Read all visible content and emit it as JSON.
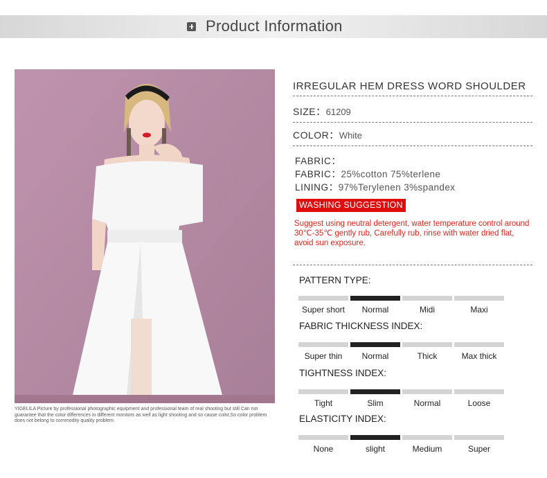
{
  "header": {
    "title": "Product Information",
    "icon": "plus-square-icon"
  },
  "photo": {
    "alt": "model wearing white off-shoulder irregular hem dress"
  },
  "caption": "YIGELILA Picture by professional photographic equipment and professional team of real shooting but still Can not guarantee that the color differences in different monitors as well as light shooting and so cause color,So color problem does not belong to commodity quality problem.",
  "product": {
    "title": "IRREGULAR HEM DRESS WORD SHOULDER",
    "size_label": "SIZE：",
    "size_value": "61209",
    "color_label": "COLOR：",
    "color_value": "White",
    "fabric_heading": "FABRIC：",
    "fabric_label": "FABRIC：",
    "fabric_value": "25%cotton 75%terlene",
    "lining_label": "LINING：",
    "lining_value": "97%Terylenen 3%spandex"
  },
  "washing": {
    "badge": "WASHING SUGGESTION",
    "text": "Suggest using neutral detergent, water temperature control around 30℃-35℃ gently rub, Carefully rub, rinse with water dried flat, avoid sun exposure.",
    "accent": "#e00b0b"
  },
  "indices": [
    {
      "title": "PATTERN TYPE:",
      "options": [
        "Super short",
        "Normal",
        "Midi",
        "Maxi"
      ],
      "selected": 1
    },
    {
      "title": "FABRIC THICKNESS INDEX:",
      "options": [
        "Super thin",
        "Normal",
        "Thick",
        "Max thick"
      ],
      "selected": 1
    },
    {
      "title": "TIGHTNESS INDEX:",
      "options": [
        "Tight",
        "Slim",
        "Normal",
        "Loose"
      ],
      "selected": 1
    },
    {
      "title": "ELASTICITY INDEX:",
      "options": [
        "None",
        "slight",
        "Medium",
        "Super"
      ],
      "selected": 1
    }
  ]
}
